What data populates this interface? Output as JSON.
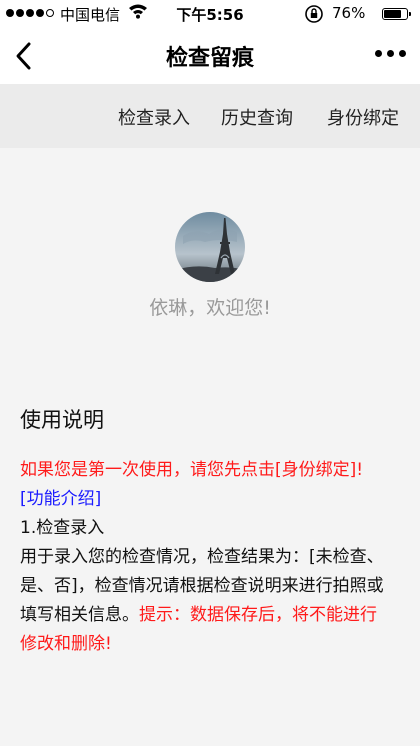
{
  "status_bar": {
    "carrier": "中国电信",
    "time": "下午5:56",
    "battery_percent": "76%",
    "battery_level": 0.76,
    "signal_icon": "signal-dots-icon",
    "wifi_icon": "wifi-icon",
    "lock_icon": "rotation-lock-icon"
  },
  "nav": {
    "back_icon": "chevron-left-icon",
    "title": "检查留痕",
    "more_icon": "more-dots-icon"
  },
  "tabs": [
    {
      "label": "检查录入"
    },
    {
      "label": "历史查询"
    },
    {
      "label": "身份绑定"
    }
  ],
  "profile": {
    "avatar_icon": "eiffel-tower-avatar",
    "welcome": "依琳，欢迎您!"
  },
  "instructions": {
    "heading": "使用说明",
    "first_use_notice": "如果您是第一次使用，请您先点击[身份绑定]!",
    "feature_link": "[功能介绍]",
    "item_1_title": "1.检查录入",
    "item_1_desc": "用于录入您的检查情况，检查结果为：[未检查、是、否]，检查情况请根据检查说明来进行拍照或填写相关信息。",
    "item_1_tip": "提示：数据保存后，将不能进行修改和删除!"
  },
  "colors": {
    "notice_red": "#ff1a1a",
    "link_blue": "#1a1aff",
    "welcome_gray": "#9a9a9a",
    "tab_bg": "#ebebeb",
    "page_bg": "#f4f4f4"
  }
}
